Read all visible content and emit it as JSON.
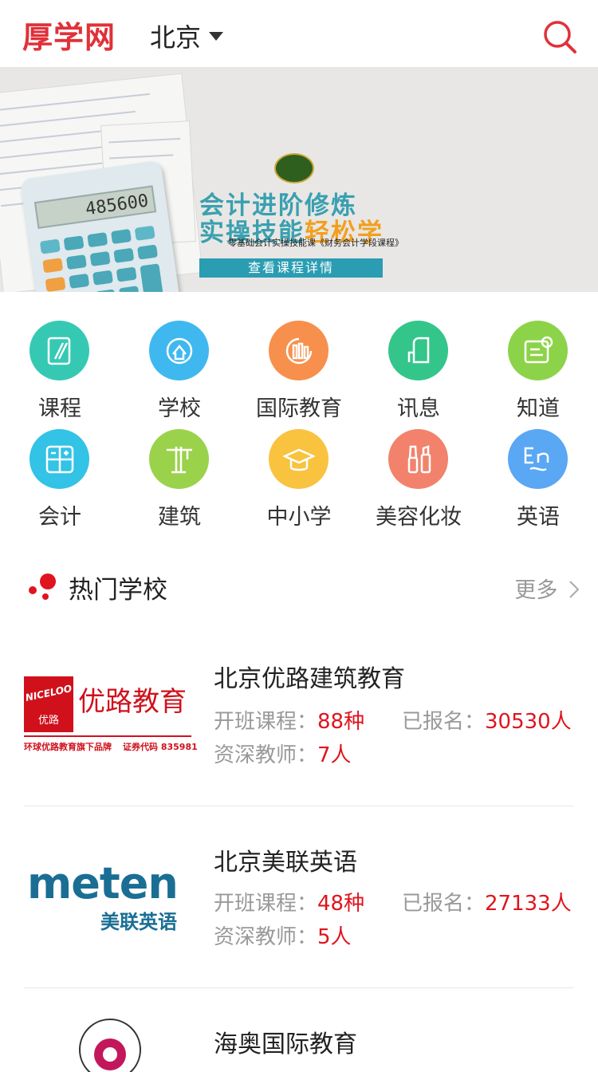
{
  "header": {
    "logo_text": "厚学网",
    "city": "北京",
    "accent_color": "#e03139"
  },
  "banner": {
    "title_line1": "会计进阶修炼",
    "title_line2_a": "实操技能",
    "title_line2_b": "轻松学",
    "subtitle": "零基础会计实操技能课《财务会计学段课程》",
    "button_label": "查看课程详情",
    "calculator_display": "485600",
    "page_indicator": {
      "current": 1,
      "total": 1
    }
  },
  "categories": [
    {
      "label": "课程",
      "color": "#35c9b4",
      "icon": "book-icon"
    },
    {
      "label": "学校",
      "color": "#3fb8f0",
      "icon": "school-icon"
    },
    {
      "label": "国际教育",
      "color": "#f7904c",
      "icon": "globe-icon"
    },
    {
      "label": "讯息",
      "color": "#34c58a",
      "icon": "news-icon"
    },
    {
      "label": "知道",
      "color": "#8dd349",
      "icon": "qa-icon"
    },
    {
      "label": "会计",
      "color": "#32c3e6",
      "icon": "calculator-icon"
    },
    {
      "label": "建筑",
      "color": "#9bd24b",
      "icon": "crane-icon"
    },
    {
      "label": "中小学",
      "color": "#f9c340",
      "icon": "graduation-cap-icon"
    },
    {
      "label": "美容化妆",
      "color": "#f2826c",
      "icon": "cosmetics-icon"
    },
    {
      "label": "英语",
      "color": "#5aa7f3",
      "icon": "english-icon"
    }
  ],
  "section": {
    "title": "热门学校",
    "more_label": "更多"
  },
  "schools": [
    {
      "name": "北京优路建筑教育",
      "courses_label": "开班课程：",
      "courses_value": "88种",
      "enrolled_label": "已报名：",
      "enrolled_value": "30530人",
      "teachers_label": "资深教师：",
      "teachers_value": "7人",
      "logo": {
        "brand": "NICELOO",
        "brand_cn": "优路",
        "name": "优路教育",
        "tagline": "环球优路教育旗下品牌",
        "code": "证券代码 835981"
      }
    },
    {
      "name": "北京美联英语",
      "courses_label": "开班课程：",
      "courses_value": "48种",
      "enrolled_label": "已报名：",
      "enrolled_value": "27133人",
      "teachers_label": "资深教师：",
      "teachers_value": "5人",
      "logo": {
        "brand": "meten",
        "name": "美联英语"
      }
    },
    {
      "name": "海奥国际教育"
    }
  ]
}
